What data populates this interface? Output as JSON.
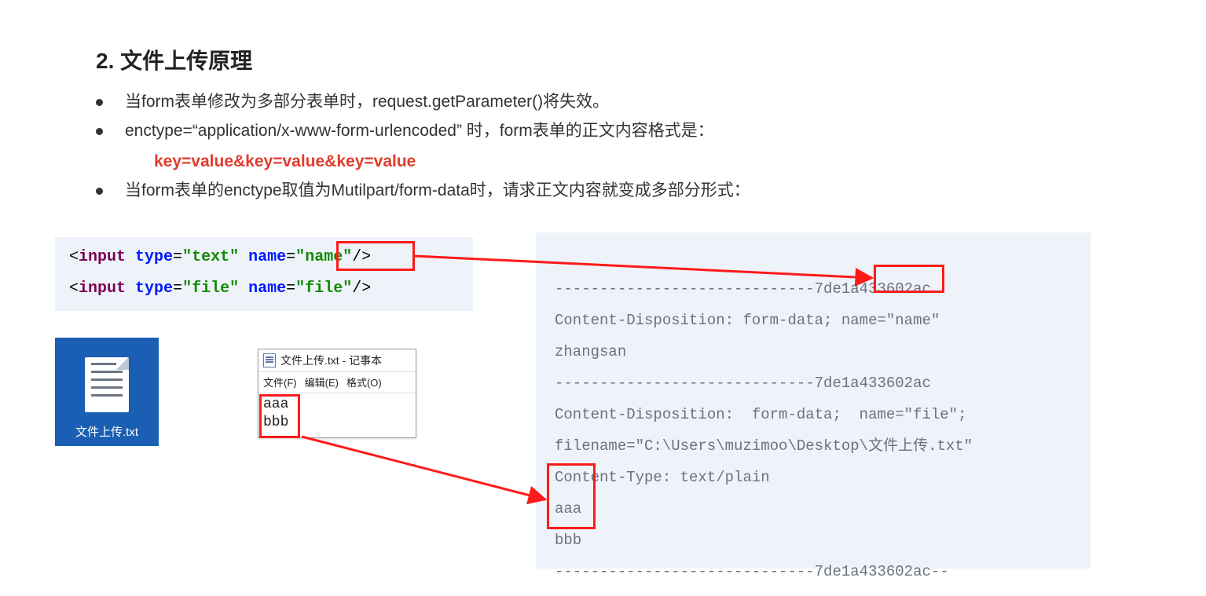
{
  "heading": "2. 文件上传原理",
  "bullets": {
    "b1": "当form表单修改为多部分表单时，request.getParameter()将失效。",
    "b2": "enctype=“application/x-www-form-urlencoded” 时，form表单的正文内容格式是：",
    "kv": "key=value&key=value&key=value",
    "b3": "当form表单的enctype取值为Mutilpart/form-data时，请求正文内容就变成多部分形式："
  },
  "code_left": {
    "lt1": "<",
    "input": "input",
    "sp": " ",
    "type": "type",
    "eq": "=",
    "q": "\"",
    "text": "text",
    "file": "file",
    "name_attr": "name",
    "name_val": "name",
    "file_val": "file",
    "slashgt": "/>"
  },
  "payload": {
    "l1": "-----------------------------7de1a433602ac",
    "l2a": "Content-Disposition: form-data; name=",
    "l2b": "\"name\"",
    "l3": "zhangsan",
    "l4": "-----------------------------7de1a433602ac",
    "l5": "Content-Disposition:  form-data;  name=\"file\";",
    "l6": "filename=\"C:\\Users\\muzimoo\\Desktop\\文件上传.txt\"",
    "l7": "Content-Type: text/plain",
    "l8": "aaa",
    "l9": "bbb",
    "l10": "-----------------------------7de1a433602ac--"
  },
  "file_tile": {
    "name": "文件上传.txt"
  },
  "notepad": {
    "title": "文件上传.txt - 记事本",
    "menu": {
      "file": "文件(F)",
      "edit": "编辑(E)",
      "format": "格式(O)"
    },
    "line1": "aaa",
    "line2": "bbb"
  }
}
